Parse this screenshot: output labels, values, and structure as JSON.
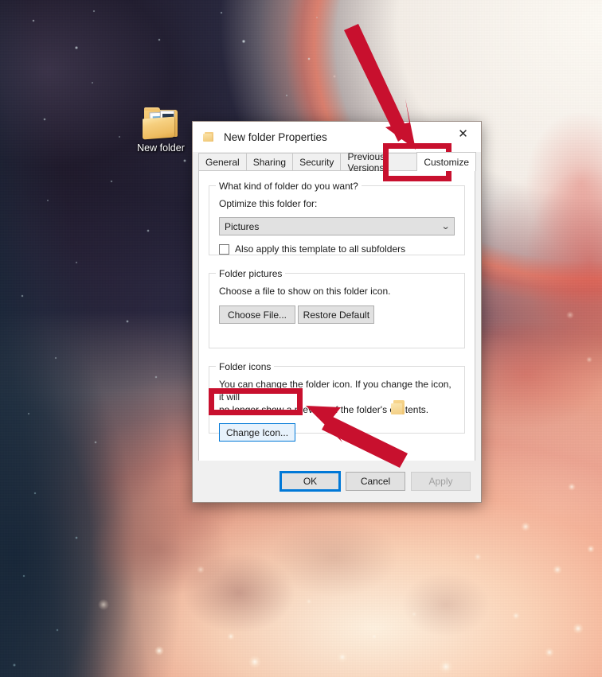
{
  "desktop": {
    "folder_shortcut": {
      "label": "New folder",
      "icon": "folder-with-documents-icon"
    },
    "wallpaper": {
      "description": "space nebula",
      "dark_color": "#231d2f",
      "cream_color": "#fbf3ea",
      "salmon_color": "#f2a189"
    }
  },
  "dialog": {
    "title": "New folder Properties",
    "title_icon": "folder-icon",
    "close_label": "✕",
    "tabs": [
      {
        "label": "General",
        "active": false
      },
      {
        "label": "Sharing",
        "active": false
      },
      {
        "label": "Security",
        "active": false
      },
      {
        "label": "Previous Versions",
        "active": false
      },
      {
        "label": "Customize",
        "active": true
      }
    ],
    "groups": {
      "folder_kind": {
        "legend": "What kind of folder do you want?",
        "combo_label": "Optimize this folder for:",
        "combo_value": "Pictures",
        "combo_chevron": "⌄",
        "checkbox_label": "Also apply this template to all subfolders",
        "checkbox_checked": false
      },
      "folder_pictures": {
        "legend": "Folder pictures",
        "description": "Choose a file to show on this folder icon.",
        "choose_file_label": "Choose File...",
        "restore_default_label": "Restore Default"
      },
      "folder_icons": {
        "legend": "Folder icons",
        "description_line1": "You can change the folder icon. If you change the icon, it will",
        "description_line2": "no longer show a preview of the folder's contents.",
        "change_icon_label": "Change Icon...",
        "preview_icon": "folder-icon"
      }
    },
    "footer": {
      "ok_label": "OK",
      "cancel_label": "Cancel",
      "apply_label": "Apply",
      "apply_disabled": true
    }
  },
  "annotations": {
    "color": "#c8102e",
    "highlight_boxes": [
      {
        "name": "customize-tab-highlight"
      },
      {
        "name": "change-icon-highlight"
      }
    ],
    "arrows": [
      {
        "name": "arrow-to-customize-tab",
        "direction": "down-right"
      },
      {
        "name": "arrow-to-change-icon",
        "direction": "up-left"
      }
    ]
  }
}
